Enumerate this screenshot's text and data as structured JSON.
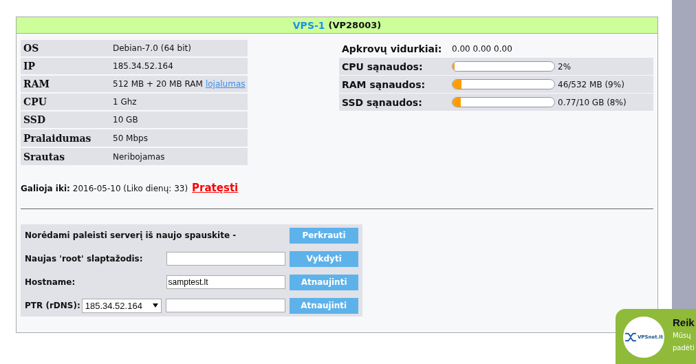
{
  "header": {
    "name": "VPS-1",
    "code": "(VP28003)"
  },
  "specs": [
    {
      "label": "OS",
      "value": "Debian-7.0 (64 bit)"
    },
    {
      "label": "IP",
      "value": "185.34.52.164"
    },
    {
      "label": "RAM",
      "value": "512 MB + 20 MB RAM",
      "link": "lojalumas"
    },
    {
      "label": "CPU",
      "value": "1 Ghz"
    },
    {
      "label": "SSD",
      "value": "10 GB"
    },
    {
      "label": "Pralaidumas",
      "value": "50 Mbps"
    },
    {
      "label": "Srautas",
      "value": "Neribojamas"
    }
  ],
  "load": {
    "label": "Apkrovų vidurkiai:",
    "value": "0.00 0.00 0.00"
  },
  "usage": [
    {
      "label": "CPU sąnaudos:",
      "level": 0.02,
      "reading": "2%"
    },
    {
      "label": "RAM sąnaudos:",
      "level": 0.09,
      "reading": "46/532 MB (9%)"
    },
    {
      "label": "SSD sąnaudos:",
      "level": 0.08,
      "reading": "0.77/10 GB (8%)"
    }
  ],
  "expiry": {
    "label": "Galioja iki:",
    "value": "2016-05-10 (Liko dienų: 33)",
    "link": "Pratęsti"
  },
  "actions": [
    {
      "kind": "text",
      "label": "Norėdami paleisti serverį iš naujo spauskite -",
      "button": "Perkrauti"
    },
    {
      "kind": "input",
      "label": "Naujas 'root' slaptažodis:",
      "button": "Vykdyti"
    },
    {
      "kind": "input",
      "label": "Hostname:",
      "value": "samptest.lt",
      "button": "Atnaujinti"
    },
    {
      "kind": "select",
      "label": "PTR (rDNS):",
      "select": "185.34.52.164",
      "button": "Atnaujinti"
    }
  ],
  "chat": {
    "logo": "VPSnet.lt",
    "title": "Reik",
    "lines": [
      "Mūsų",
      "padėti"
    ]
  }
}
